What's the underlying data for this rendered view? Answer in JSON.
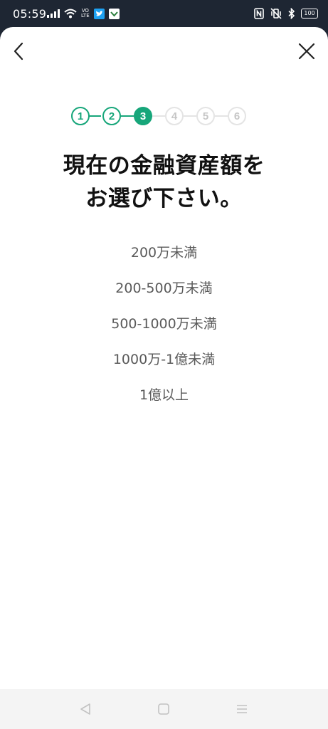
{
  "status_bar": {
    "time": "05:59",
    "volte_top": "VO",
    "volte_bottom": "LTE",
    "battery": "100",
    "icons": [
      "signal-icon",
      "wifi-icon",
      "twitter-icon",
      "app-notification-icon",
      "nfc-icon",
      "vibrate-icon",
      "bluetooth-icon",
      "battery-icon"
    ]
  },
  "header": {
    "back_icon": "chevron-left-icon",
    "close_icon": "close-icon"
  },
  "stepper": {
    "steps": [
      {
        "label": "1",
        "state": "done"
      },
      {
        "label": "2",
        "state": "done"
      },
      {
        "label": "3",
        "state": "current"
      },
      {
        "label": "4",
        "state": "todo"
      },
      {
        "label": "5",
        "state": "todo"
      },
      {
        "label": "6",
        "state": "todo"
      }
    ]
  },
  "question": {
    "line1": "現在の金融資産額を",
    "line2": "お選び下さい。"
  },
  "options": [
    "200万未満",
    "200-500万未満",
    "500-1000万未満",
    "1000万-1億未満",
    "1億以上"
  ],
  "colors": {
    "accent": "#17a67a",
    "inactive_step": "#e4e4e4",
    "option_text": "#5a5a5a",
    "status_bar_bg": "#1e2633"
  },
  "nav_bar": {
    "icons": [
      "back-triangle-icon",
      "home-square-icon",
      "menu-lines-icon"
    ]
  }
}
